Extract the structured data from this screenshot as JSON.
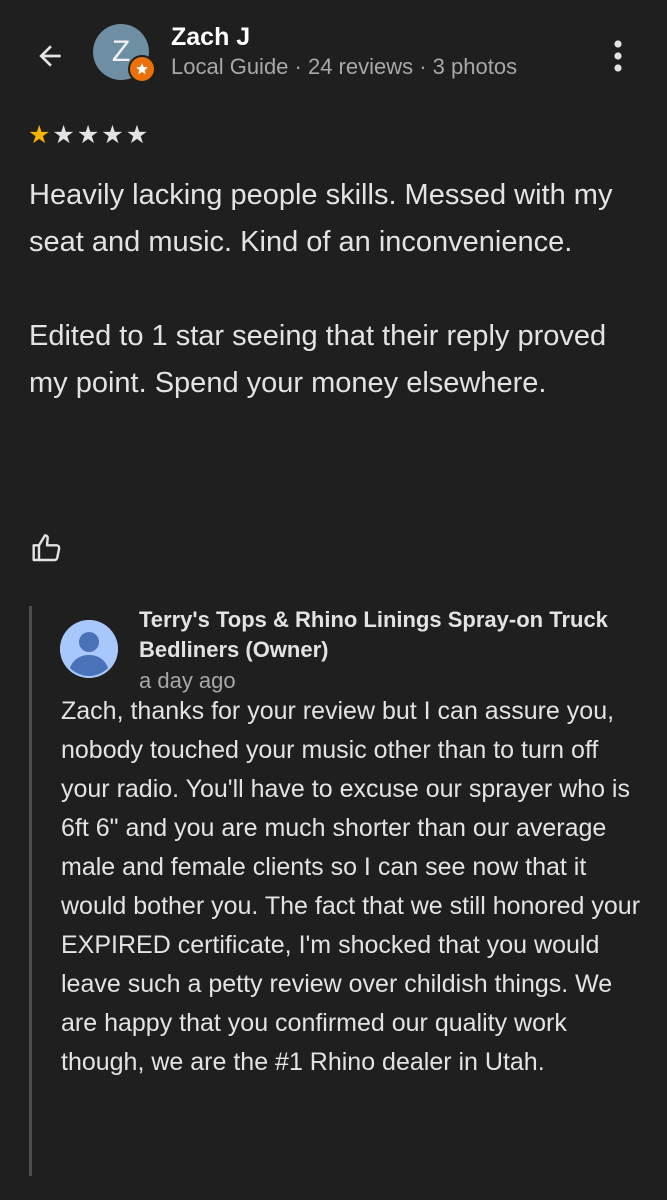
{
  "header": {
    "back_icon": "arrow-back-icon",
    "avatar_letter": "Z",
    "badge_icon": "local-guide-star-icon",
    "name": "Zach J",
    "meta": "Local Guide · 24 reviews · 3 photos",
    "more_icon": "more-vert-icon"
  },
  "review": {
    "rating": 1,
    "rating_max": 5,
    "star_filled_color": "#f6b400",
    "text": "Heavily lacking people skills. Messed with my seat and music. Kind of an inconvenience.\n\nEdited to 1 star seeing that their reply proved my point. Spend your money elsewhere.",
    "like_icon": "thumbs-up-icon"
  },
  "owner_reply": {
    "name": "Terry's Tops & Rhino Linings Spray-on Truck Bedliners (Owner)",
    "time": "a day ago",
    "text": "Zach, thanks for your review but I can assure you, nobody touched your music other than to turn off your radio. You'll have to excuse our sprayer who is 6ft 6\" and you are much shorter than our average male and female clients so I can see now that it would bother you. The fact that we still honored your EXPIRED certificate, I'm shocked that you would leave such a petty review over childish things. We are happy that you confirmed our quality work though, we are the #1 Rhino dealer in Utah.",
    "avatar_icon": "person-avatar-icon"
  }
}
